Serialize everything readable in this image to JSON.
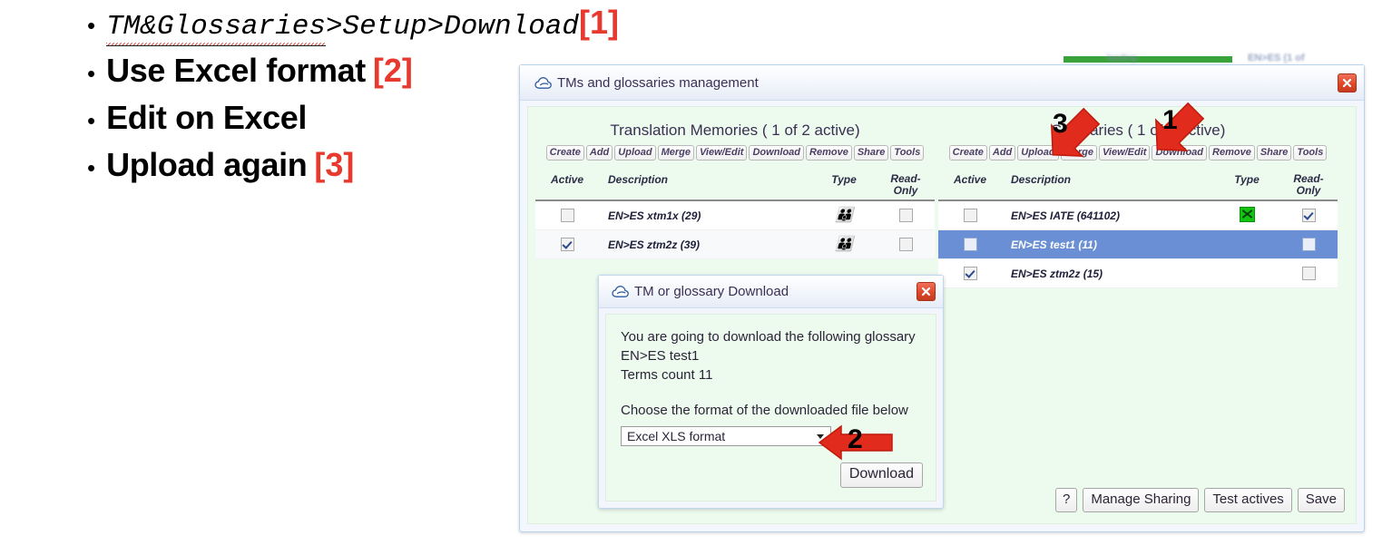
{
  "slide": {
    "bullets": [
      {
        "text": "TM&Glossaries",
        "text2": ">Setup>Download",
        "marker": "[1]",
        "style": "code"
      },
      {
        "text": "Use Excel format",
        "marker": "[2]",
        "style": "normal"
      },
      {
        "text": "Edit on Excel",
        "marker": "",
        "style": "normal"
      },
      {
        "text": "Upload again",
        "marker": "[3]",
        "style": "normal"
      }
    ]
  },
  "background": {
    "blurred_text_right": "EN>ES (1 of",
    "blurred_text_left": "loading"
  },
  "main_dialog": {
    "title": "TMs and glossaries management",
    "title_icon": "cloud-icon",
    "close_icon": "close-icon",
    "tm_panel": {
      "heading": "Translation Memories  ( 1 of 2 active)",
      "toolbar": [
        "Create",
        "Add",
        "Upload",
        "Merge",
        "View/Edit",
        "Download",
        "Remove",
        "Share",
        "Tools"
      ],
      "columns": [
        "Active",
        "Description",
        "Type",
        "Read-Only"
      ],
      "rows": [
        {
          "active": false,
          "description": "EN>ES xtm1x (29)",
          "type": "people-icon",
          "readonly": false,
          "selected": false
        },
        {
          "active": true,
          "description": "EN>ES ztm2z (39)",
          "type": "people-icon",
          "readonly": false,
          "selected": false
        }
      ]
    },
    "glossary_panel": {
      "heading": "Glossaries  ( 1 of 3 active)",
      "toolbar": [
        "Create",
        "Add",
        "Upload",
        "Merge",
        "View/Edit",
        "Download",
        "Remove",
        "Share",
        "Tools"
      ],
      "columns": [
        "Active",
        "Description",
        "Type",
        "Read-Only"
      ],
      "rows": [
        {
          "active": false,
          "description": "EN>ES IATE (641102)",
          "type": "excel-icon",
          "readonly": true,
          "selected": false
        },
        {
          "active": false,
          "description": "EN>ES test1 (11)",
          "type": "",
          "readonly": false,
          "selected": true
        },
        {
          "active": true,
          "description": "EN>ES ztm2z (15)",
          "type": "",
          "readonly": false,
          "selected": false
        }
      ]
    },
    "footer_buttons": [
      "?",
      "Manage Sharing",
      "Test actives",
      "Save"
    ]
  },
  "download_dialog": {
    "title": "TM or glossary Download",
    "title_icon": "cloud-icon",
    "close_icon": "close-icon",
    "line1": "You are going to download the following glossary",
    "line2": "EN>ES test1",
    "line3": "Terms count 11",
    "prompt": "Choose the format of the downloaded file below",
    "format_value": "Excel XLS format",
    "download_button": "Download"
  },
  "annotations": [
    {
      "label": "3",
      "target": "glossary-upload-button"
    },
    {
      "label": "1",
      "target": "glossary-download-button"
    },
    {
      "label": "2",
      "target": "format-select"
    }
  ],
  "colors": {
    "accent_red": "#e8392f",
    "arrow_red": "#e02b1d",
    "panel_green": "#edfbee",
    "row_selected_blue": "#6a8fd4",
    "excel_green": "#12c412"
  }
}
